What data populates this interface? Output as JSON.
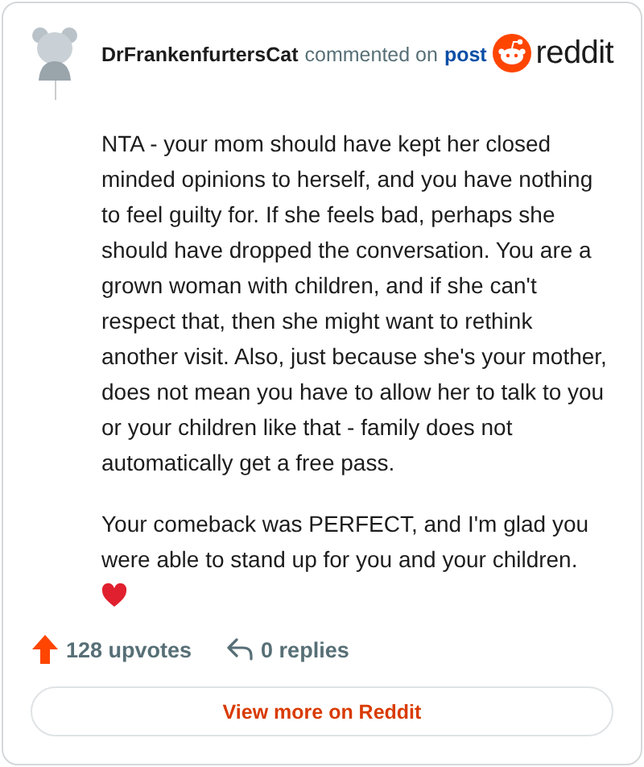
{
  "header": {
    "author": "DrFrankenfurtersCat",
    "action": "commented on",
    "link": "post",
    "brand": "reddit"
  },
  "comment": {
    "paragraphs": [
      "NTA - your mom should have kept her closed minded opinions to herself, and you have nothing to feel guilty for. If she feels bad, perhaps she should have dropped the conversation. You are a grown woman with children, and if she can't respect that, then she might want to rethink another visit. Also, just because she's your mother, does not mean you have to allow her to talk to you or your children like that - family does not automatically get a free pass.",
      "Your comeback was PERFECT, and I'm glad you were able to stand up for you and your children."
    ]
  },
  "stats": {
    "upvotes": "128 upvotes",
    "replies": "0 replies"
  },
  "button": "View more on Reddit"
}
